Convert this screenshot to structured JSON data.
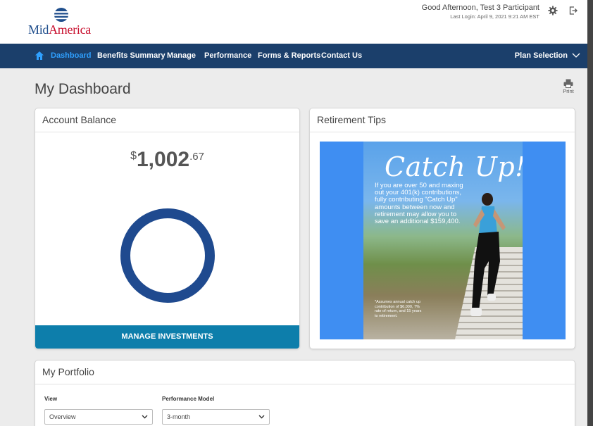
{
  "header": {
    "logo_text_1": "Mid",
    "logo_text_2": "America",
    "greeting": "Good Afternoon,  Test 3 Participant",
    "last_login": "Last Login: April 9, 2021 9:21 AM EST"
  },
  "nav": {
    "items": [
      {
        "label": "Dashboard"
      },
      {
        "label": "Benefits Summary"
      },
      {
        "label": "Manage"
      },
      {
        "label": "Performance"
      },
      {
        "label": "Forms & Reports"
      },
      {
        "label": "Contact Us"
      }
    ],
    "plan_selection": "Plan Selection"
  },
  "page": {
    "title": "My Dashboard",
    "print_label": "Print"
  },
  "account_balance": {
    "title": "Account Balance",
    "currency": "$",
    "dollars": "1,002",
    "cents": ".67",
    "button": "MANAGE INVESTMENTS"
  },
  "retirement_tips": {
    "title": "Retirement Tips",
    "headline": "Catch Up!",
    "body": "If you are over 50 and maxing out your 401(k) contributions, fully contributing \"Catch Up\" amounts between now and retirement may allow you to save an additional $159,400.",
    "footnote": "*Assumes annual catch up contribution of $6,000, 7% rate of return, and 15 years to retirement."
  },
  "portfolio": {
    "title": "My Portfolio",
    "view_label": "View",
    "view_value": "Overview",
    "model_label": "Performance Model",
    "model_value": "3-month"
  },
  "colors": {
    "nav_bg": "#1b3f6b",
    "nav_active": "#2fa0ff",
    "button_bg": "#0d7eab",
    "donut": "#1f4a8f"
  }
}
